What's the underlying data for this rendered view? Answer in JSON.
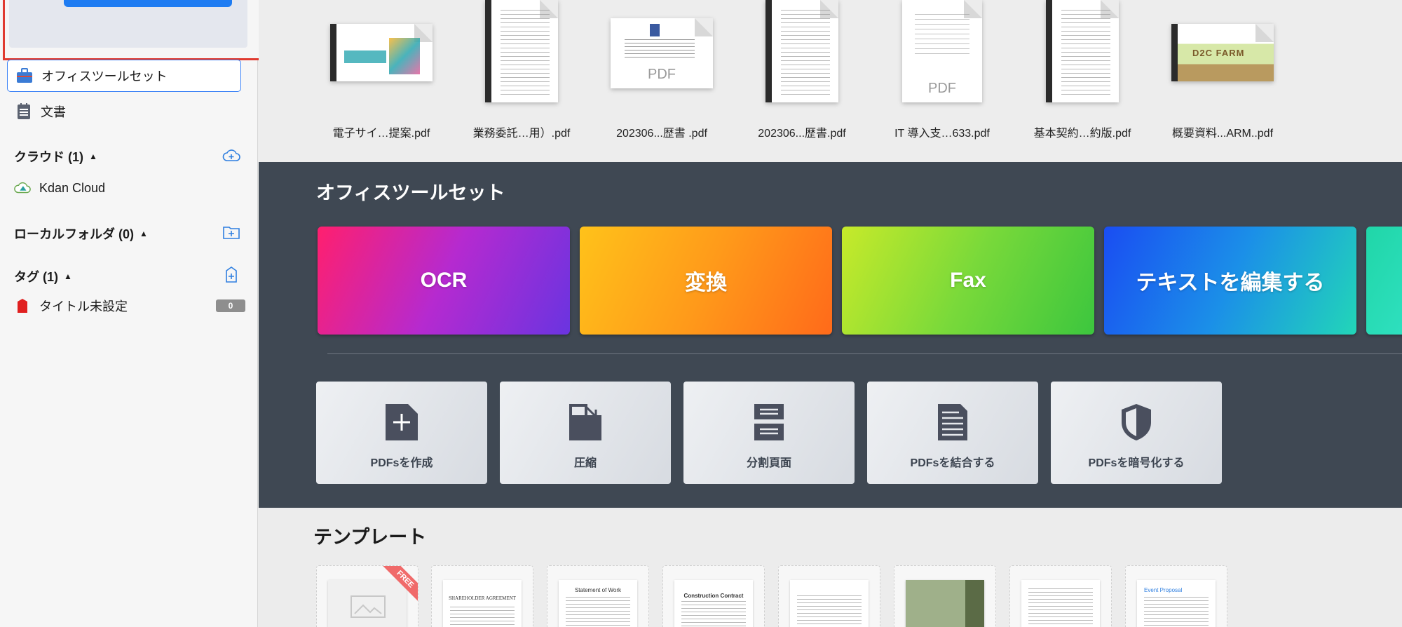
{
  "sidebar": {
    "items": [
      {
        "label": "オフィスツールセット",
        "icon": "toolbox-icon",
        "active": true
      },
      {
        "label": "文書",
        "icon": "document-icon",
        "active": false
      }
    ],
    "cloud": {
      "heading": "クラウド (1)",
      "items": [
        {
          "label": "Kdan Cloud"
        }
      ]
    },
    "local": {
      "heading": "ローカルフォルダ (0)"
    },
    "tags": {
      "heading": "タグ (1)",
      "items": [
        {
          "label": "タイトル未設定",
          "count": "0"
        }
      ]
    }
  },
  "recent_files": [
    {
      "name": "電子サイ…提案.pdf"
    },
    {
      "name": "業務委託…用）.pdf"
    },
    {
      "name": "202306...歴書 .pdf",
      "thumb_text": "PDF"
    },
    {
      "name": "202306...歴書.pdf"
    },
    {
      "name": "IT 導入支…633.pdf",
      "thumb_text": "PDF"
    },
    {
      "name": "基本契約…約版.pdf"
    },
    {
      "name": "概要資料...ARM..pdf"
    }
  ],
  "tools": {
    "title": "オフィスツールセット",
    "banners": [
      {
        "label": "OCR",
        "colors": [
          "#ff1f6e",
          "#b52ad0",
          "#6a34e0"
        ]
      },
      {
        "label": "変換",
        "colors": [
          "#ffc21a",
          "#ff9a1a",
          "#ff6a1a"
        ]
      },
      {
        "label": "Fax",
        "colors": [
          "#c7ea2a",
          "#79d93a",
          "#3cc63e"
        ]
      },
      {
        "label": "テキストを編集する",
        "colors": [
          "#1a4df2",
          "#1b8fe8",
          "#22d6b8"
        ]
      }
    ],
    "cards": [
      {
        "label": "PDFsを作成",
        "icon": "create-pdf-icon"
      },
      {
        "label": "圧縮",
        "icon": "compress-icon"
      },
      {
        "label": "分割頁面",
        "icon": "split-pages-icon"
      },
      {
        "label": "PDFsを結合する",
        "icon": "merge-pdf-icon"
      },
      {
        "label": "PDFsを暗号化する",
        "icon": "encrypt-pdf-icon"
      }
    ]
  },
  "templates": {
    "title": "テンプレート",
    "items": [
      {
        "badge": "FREE"
      },
      {
        "title": "SHAREHOLDER AGREEMENT"
      },
      {
        "title": "Statement of Work"
      },
      {
        "title": "Construction Contract"
      },
      {
        "title": ""
      },
      {
        "title": ""
      },
      {
        "title": ""
      },
      {
        "title": "Event Proposal"
      }
    ]
  }
}
